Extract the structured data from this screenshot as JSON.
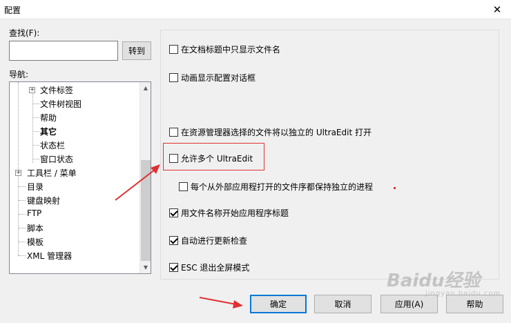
{
  "window": {
    "title": "配置"
  },
  "search": {
    "label": "查找(F):",
    "value": "",
    "go_button": "转到"
  },
  "nav": {
    "label": "导航:",
    "items": [
      {
        "label": "文件标签",
        "has_expander": true
      },
      {
        "label": "文件树视图"
      },
      {
        "label": "帮助"
      },
      {
        "label": "其它",
        "bold": true
      },
      {
        "label": "状态栏"
      },
      {
        "label": "窗口状态"
      },
      {
        "label": "工具栏 / 菜单",
        "has_expander": true
      },
      {
        "label": "目录"
      },
      {
        "label": "键盘映射"
      },
      {
        "label": "FTP"
      },
      {
        "label": "脚本"
      },
      {
        "label": "模板"
      },
      {
        "label": "XML 管理器"
      }
    ]
  },
  "options": [
    {
      "label": "在文档标题中只显示文件名",
      "checked": false
    },
    {
      "label": "动画显示配置对话框",
      "checked": false
    },
    {
      "label": "在资源管理器选择的文件将以独立的 UltraEdit 打开",
      "checked": false
    },
    {
      "label": "允许多个 UltraEdit",
      "checked": false
    },
    {
      "label": "每个从外部应用程打开的文件序都保持独立的进程",
      "checked": false
    },
    {
      "label": "用文件名称开始应用程序标题",
      "checked": true
    },
    {
      "label": "自动进行更新检查",
      "checked": true
    },
    {
      "label": "ESC 退出全屏模式",
      "checked": true
    }
  ],
  "buttons": {
    "ok": "确定",
    "cancel": "取消",
    "apply": "应用(A)",
    "help": "帮助"
  },
  "watermark": {
    "text": "Baidu经验",
    "sub": "jingyan.baidu.com"
  },
  "colors": {
    "highlight": "#e03030",
    "focus": "#0078d7"
  }
}
